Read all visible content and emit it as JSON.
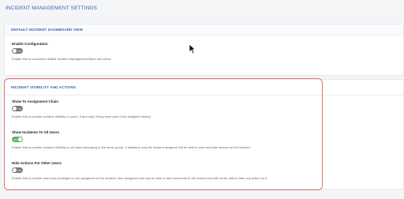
{
  "page": {
    "title": "INCIDENT MANAGEMENT SETTINGS"
  },
  "dashboard_section": {
    "header": "DEFAULT INCIDENT DASHBOARD VIEW",
    "settings": [
      {
        "label": "Enable Configuration",
        "toggle_state": "NO",
        "enabled": false,
        "description": "Enable this to customize default Incident Management filters and views"
      }
    ]
  },
  "visibility_section": {
    "header": "INCIDENT VISIBILITY AND ACTIONS",
    "settings": [
      {
        "label": "Show To Assignment Chain",
        "toggle_state": "NO",
        "enabled": false,
        "description": "Enable this to provide incident visibility to users, if and only, if they were part of the assignee history."
      },
      {
        "label": "Show Incidents To All Users",
        "toggle_state": "YES",
        "enabled": true,
        "description": "Enable this to provide Incident Visibility to all users belonging to the same group. If disabled, only the incident assignee will be able to view and take actions on the incident."
      },
      {
        "label": "Hide Actions For Other Users",
        "toggle_state": "NO",
        "enabled": false,
        "description": "Enable this to provide read-only privileges to non-assignees of the incident. Non-assignees will only be able to add comments to the incident but will not be able to take any action on it"
      }
    ]
  },
  "colors": {
    "accent": "#3b63b5",
    "toggle_on": "#5bb35b",
    "toggle_off": "#7a7a7a",
    "highlight": "#e4776e"
  },
  "icons": {
    "cursor": "mouse-pointer-icon"
  }
}
